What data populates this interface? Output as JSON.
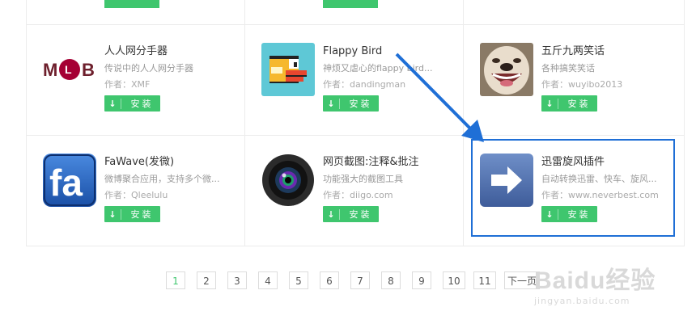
{
  "apps": [
    {
      "title": "人人网分手器",
      "desc": "传说中的人人网分手器",
      "author": "作者：XMF",
      "icon": "lg-logo-icon",
      "logo_text": "M LG B"
    },
    {
      "title": "Flappy Bird",
      "desc": "神烦又虐心的flappy bird...",
      "author": "作者：dandingman",
      "icon": "flappy-bird-icon"
    },
    {
      "title": "五斤九两笑话",
      "desc": "各种搞笑笑话",
      "author": "作者：wuyibo2013",
      "icon": "smiling-dog-icon"
    },
    {
      "title": "FaWave(发微)",
      "desc": "微博聚合应用，支持多个微...",
      "author": "作者：Qleelulu",
      "icon": "fawave-icon",
      "logo_text": "fa"
    },
    {
      "title": "网页截图:注释&批注",
      "desc": "功能强大的截图工具",
      "author": "作者：diigo.com",
      "icon": "camera-lens-icon"
    },
    {
      "title": "迅雷旋风插件",
      "desc": "自动转换迅雷、快车、旋风...",
      "author": "作者：www.neverbest.com",
      "icon": "right-arrow-icon"
    }
  ],
  "install_label": "安装",
  "pagination": {
    "pages": [
      "1",
      "2",
      "3",
      "4",
      "5",
      "6",
      "7",
      "8",
      "9",
      "10",
      "11"
    ],
    "active": "1",
    "next": "下一页"
  },
  "watermark": {
    "main": "Baidu经验",
    "sub": "jingyan.baidu.com"
  },
  "colors": {
    "install_green": "#3fc66e",
    "highlight_blue": "#1f6fd6"
  }
}
